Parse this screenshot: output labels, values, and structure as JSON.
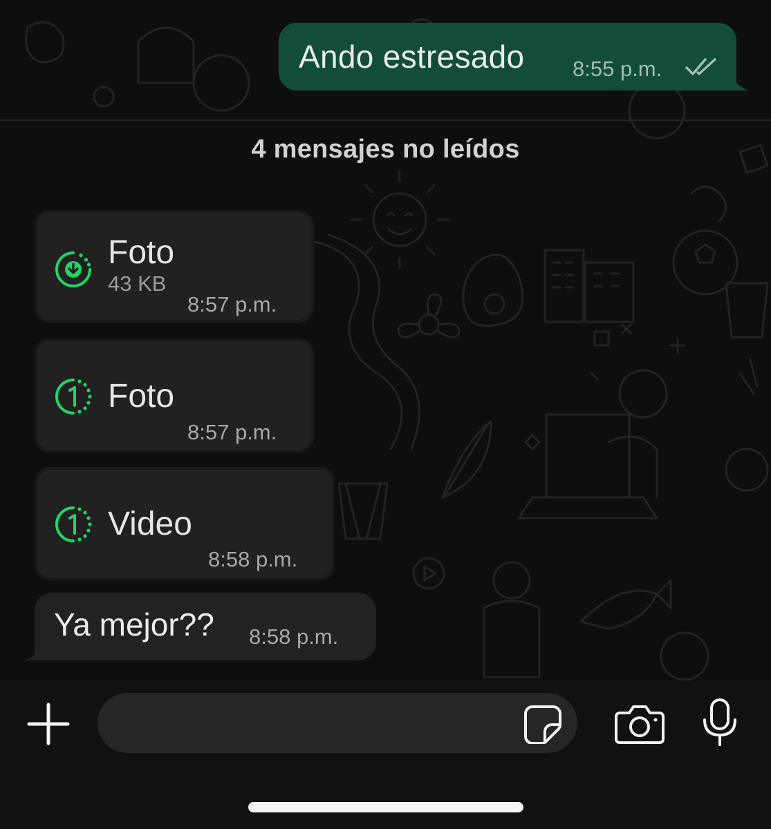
{
  "chat": {
    "outgoing": {
      "text": "Ando estresado",
      "time": "8:55 p.m.",
      "status_icon": "double-check-icon"
    },
    "unread_label": "4 mensajes no leídos",
    "media_messages": [
      {
        "label": "Foto",
        "size": "43 KB",
        "time": "8:57 p.m.",
        "icon": "download-progress-icon"
      },
      {
        "label": "Foto",
        "time": "8:57 p.m.",
        "icon": "view-once-icon"
      },
      {
        "label": "Video",
        "time": "8:58 p.m.",
        "icon": "view-once-icon"
      }
    ],
    "incoming": {
      "text": "Ya mejor??",
      "time": "8:58 p.m."
    }
  },
  "composer": {
    "attach_icon": "plus-icon",
    "input_value": "",
    "sticker_icon": "sticker-icon",
    "camera_icon": "camera-icon",
    "mic_icon": "microphone-icon"
  },
  "colors": {
    "accent_green": "#25d366",
    "outgoing_bubble": "#134d37",
    "incoming_bubble": "#222222",
    "background": "#0e0e0e"
  }
}
